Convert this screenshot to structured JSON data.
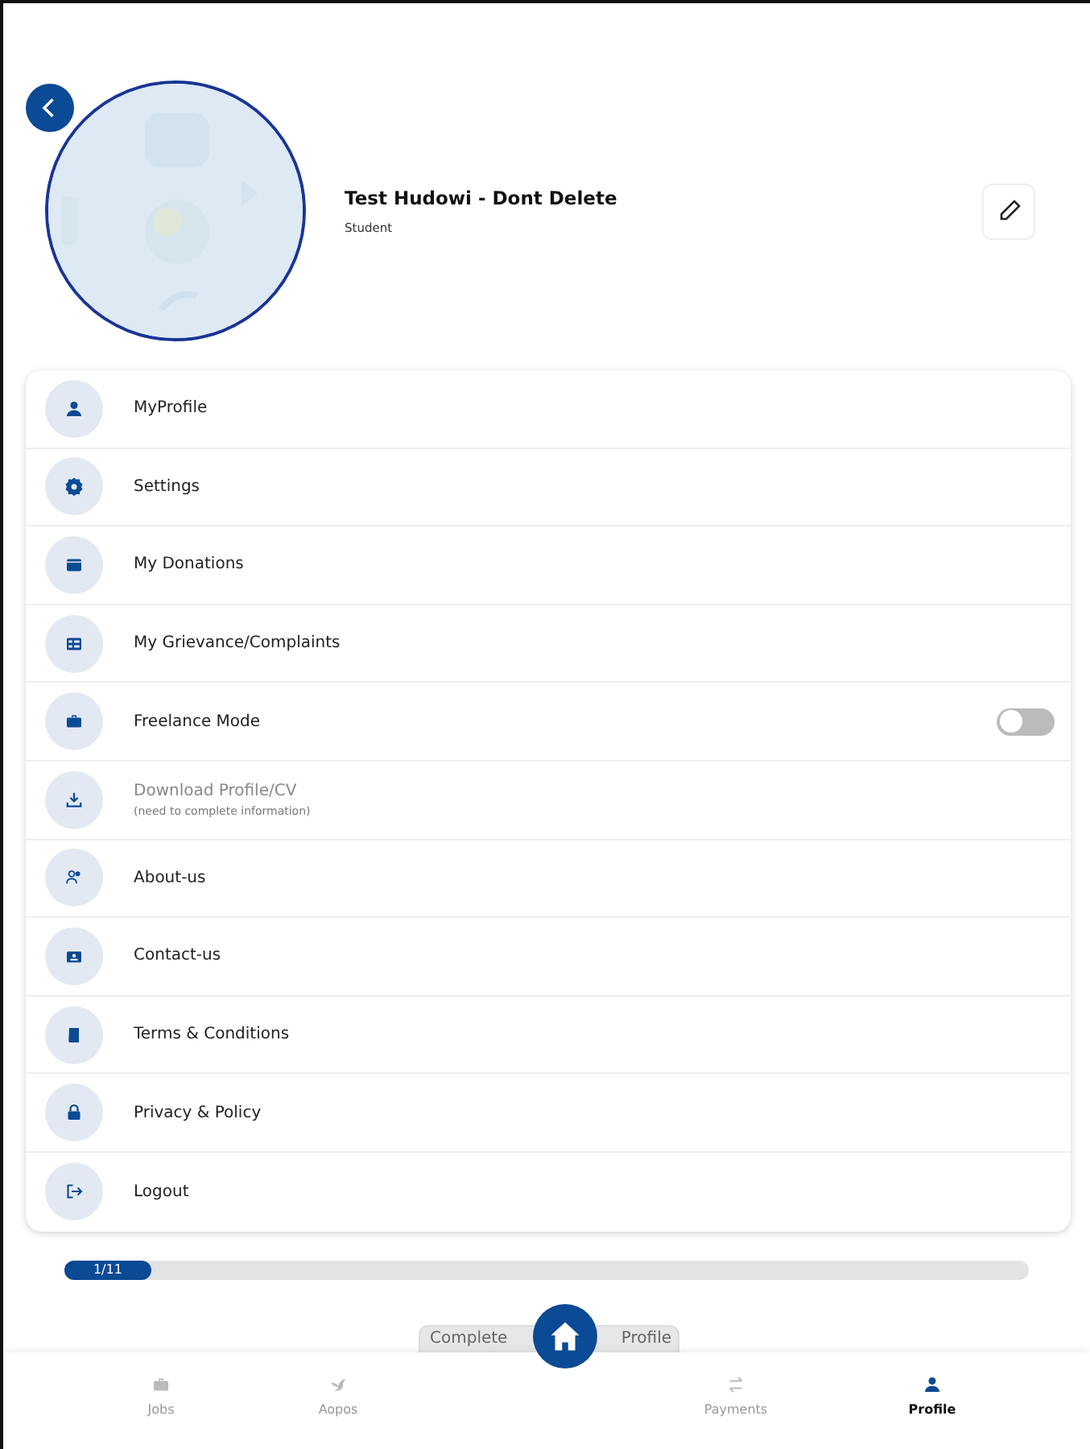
{
  "profile": {
    "name": "Test Hudowi - Dont Delete",
    "role": "Student"
  },
  "menu": [
    {
      "kind": "link",
      "label": "MyProfile",
      "disabled": false
    },
    {
      "kind": "link",
      "label": "Settings",
      "disabled": false
    },
    {
      "kind": "link",
      "label": "My Donations",
      "disabled": false
    },
    {
      "kind": "link",
      "label": "My Grievance/Complaints",
      "disabled": false
    },
    {
      "kind": "toggle",
      "label": "Freelance Mode",
      "disabled": false,
      "on": false
    },
    {
      "kind": "link",
      "label": "Download Profile/CV",
      "note": "(need to complete information)",
      "disabled": true
    },
    {
      "kind": "link",
      "label": "About-us",
      "disabled": false
    },
    {
      "kind": "link",
      "label": "Contact-us",
      "disabled": false
    },
    {
      "kind": "link",
      "label": "Terms & Conditions",
      "disabled": false
    },
    {
      "kind": "link",
      "label": "Privacy & Policy",
      "disabled": false
    },
    {
      "kind": "link",
      "label": "Logout",
      "disabled": false
    }
  ],
  "progress": {
    "level": 0.09,
    "reading": "1/11"
  },
  "complete_button": "Complete Profile",
  "bottom_nav": [
    {
      "label": "Jobs",
      "selected": false
    },
    {
      "label": "Aopos",
      "selected": false
    },
    {
      "label": "Payments",
      "selected": false
    },
    {
      "label": "Profile",
      "selected": true
    }
  ]
}
